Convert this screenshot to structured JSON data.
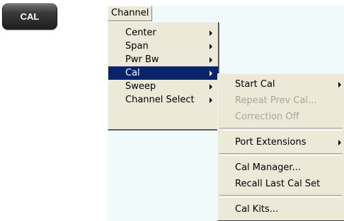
{
  "hardkey": {
    "label": "CAL"
  },
  "menubar": {
    "channel_label": "Channel"
  },
  "channel_menu": {
    "items": [
      {
        "label": "Center",
        "has_submenu": true
      },
      {
        "label": "Span",
        "has_submenu": true
      },
      {
        "label": "Pwr Bw",
        "has_submenu": true
      },
      {
        "label": "Cal",
        "has_submenu": true,
        "highlighted": true
      },
      {
        "label": "Sweep",
        "has_submenu": true
      },
      {
        "label": "Channel Select",
        "has_submenu": true
      }
    ]
  },
  "cal_menu": {
    "items": [
      {
        "label": "Start Cal",
        "has_submenu": true,
        "enabled": true
      },
      {
        "label": "Repeat Prev Cal...",
        "has_submenu": false,
        "enabled": false
      },
      {
        "label": "Correction Off",
        "has_submenu": false,
        "enabled": false
      },
      {
        "label": "Port Extensions",
        "has_submenu": true,
        "enabled": true
      },
      {
        "label": "Cal Manager...",
        "has_submenu": false,
        "enabled": true
      },
      {
        "label": "Recall Last Cal Set",
        "has_submenu": false,
        "enabled": true
      },
      {
        "label": "Cal Kits...",
        "has_submenu": false,
        "enabled": true
      }
    ]
  },
  "colors": {
    "menu_background": "#ece9d8",
    "highlight": "#0a246a",
    "disabled_text": "#a8a69a",
    "app_background": "#f0fafa",
    "hardkey_background": "#2a2a2a"
  }
}
